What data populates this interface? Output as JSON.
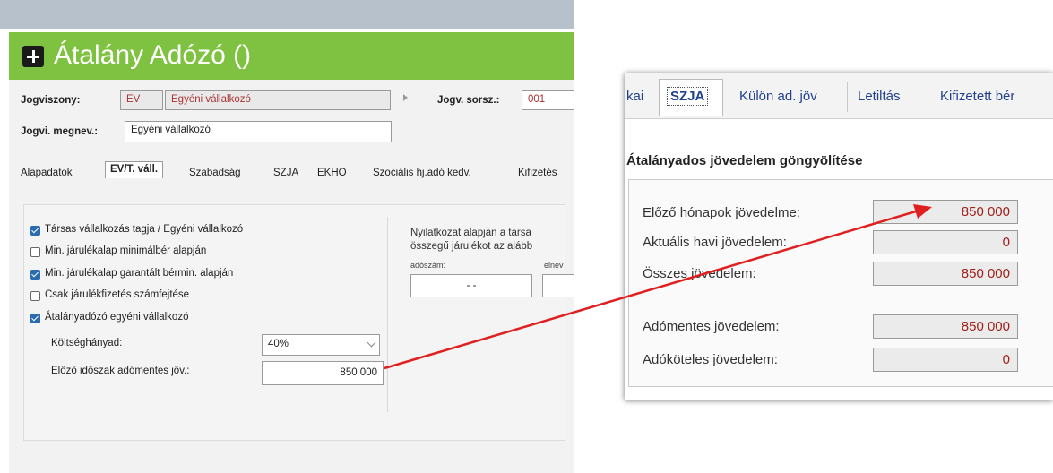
{
  "left": {
    "title": "Átalány Adózó ()",
    "jogviszony": {
      "label": "Jogviszony:",
      "code": "EV",
      "value": "Egyéni vállalkozó"
    },
    "jogv_sorsz": {
      "label": "Jogv. sorsz.:",
      "value": "001"
    },
    "jogvi_megnev": {
      "label": "Jogvi. megnev.:",
      "value": "Egyéni vállalkozó"
    },
    "tabs": [
      "Alapadatok",
      "EV/T. váll.",
      "Szabadság",
      "SZJA",
      "EKHO",
      "Szociális hj.adó kedv.",
      "Kifizetés"
    ],
    "checkboxes": [
      {
        "label": "Társas vállalkozás tagja / Egyéni vállalkozó",
        "checked": true
      },
      {
        "label": "Min. járulékalap minimálbér alapján",
        "checked": false
      },
      {
        "label": "Min. járulékalap garantált bérmin. alapján",
        "checked": true
      },
      {
        "label": "Csak járulékfizetés számfejtése",
        "checked": false
      },
      {
        "label": "Átalányadózó egyéni vállalkozó",
        "checked": true
      }
    ],
    "koltseghanyad": {
      "label": "Költséghányad:",
      "value": "40%"
    },
    "elozo_idoszak": {
      "label": "Előző időszak adómentes jöv.:",
      "value": "850 000"
    },
    "note_line1": "Nyilatkozat alapján a társa",
    "note_line2": "összegű járulékot az alább",
    "adoszam_label": "adószám:",
    "adoszam_value": "- -",
    "elnev_label": "elnev"
  },
  "right": {
    "tabs": [
      "kai",
      "SZJA",
      "Külön ad. jöv",
      "Letiltás",
      "Kifizetett bér"
    ],
    "heading": "Átalányados jövedelem göngyölítése",
    "rows": [
      {
        "label": "Előző hónapok jövedelme:",
        "value": "850 000"
      },
      {
        "label": "Aktuális havi jövedelem:",
        "value": "0"
      },
      {
        "label": "Összes jövedelem:",
        "value": "850 000"
      },
      {
        "label": "Adómentes jövedelem:",
        "value": "850 000"
      },
      {
        "label": "Adóköteles jövedelem:",
        "value": "0"
      }
    ]
  },
  "colors": {
    "title_bar": "#7fc242",
    "arrow": "#e02020",
    "value_text": "#a0201a",
    "checkbox_on": "#2b6cb0"
  }
}
